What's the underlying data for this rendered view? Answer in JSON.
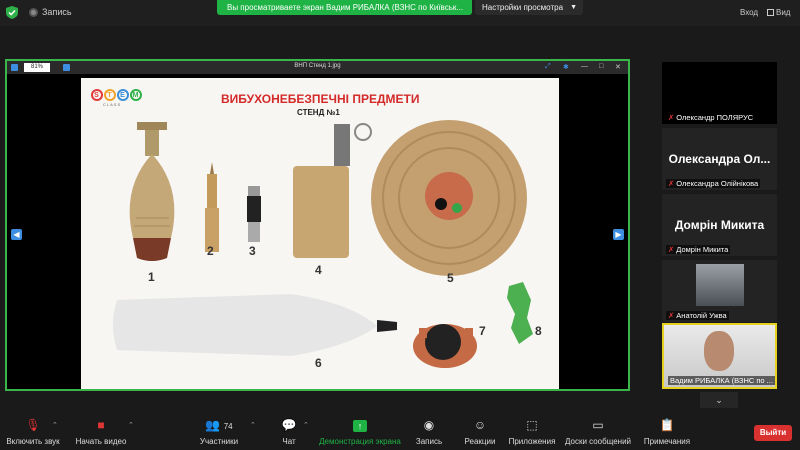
{
  "topbar": {
    "record_label": "Запись",
    "share_banner": "Вы просматриваете экран Вадим РИБАЛКА (ВЗНС по Київськ...",
    "view_settings": "Настройки просмотра",
    "enter_label": "Вход",
    "view_label": "Вид"
  },
  "share": {
    "zoom": "81%",
    "file_title": "ВНП Стенд 1.jpg",
    "slide": {
      "logo_letters": [
        "S",
        "T",
        "E",
        "M"
      ],
      "logo_sub": "CLASS",
      "title": "ВИБУХОНЕБЕЗПЕЧНІ ПРЕДМЕТИ",
      "subtitle": "СТЕНД №1",
      "numbers": [
        "1",
        "2",
        "3",
        "4",
        "5",
        "6",
        "7",
        "8"
      ]
    }
  },
  "participants": [
    {
      "tile_name": "",
      "label": "Олександр ПОЛЯРУС"
    },
    {
      "tile_name": "Олександра Ол...",
      "label": "Олександра Олійнікова"
    },
    {
      "tile_name": "Домрін Микита",
      "label": "Домрін Микита"
    },
    {
      "tile_name": "",
      "label": "Анатолій Ужва"
    },
    {
      "tile_name": "",
      "label": "Вадим РИБАЛКА (ВЗНС по ..."
    }
  ],
  "toolbar": {
    "mute": "Включить звук",
    "video": "Начать видео",
    "participants": "Участники",
    "participants_count": "74",
    "chat": "Чат",
    "share": "Демонстрация экрана",
    "record": "Запись",
    "reactions": "Реакции",
    "apps": "Приложения",
    "whiteboards": "Доски сообщений",
    "notes": "Примечания",
    "exit": "Выйти"
  },
  "colors": {
    "accent_green": "#1fb345",
    "active_border": "#e6d21e",
    "exit_red": "#d93030",
    "title_red": "#d42a2a"
  }
}
